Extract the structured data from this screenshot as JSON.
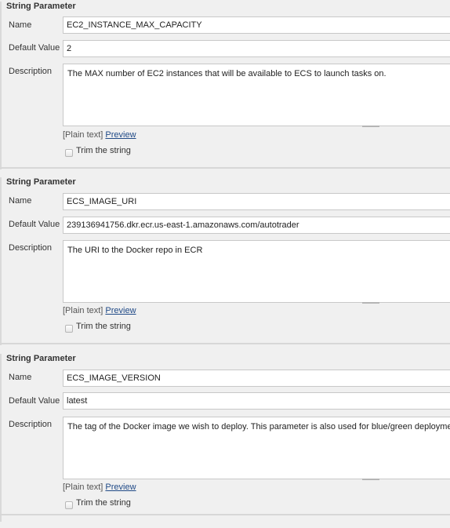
{
  "parameters": [
    {
      "section_title": "String Parameter",
      "name_label": "Name",
      "name_value": "EC2_INSTANCE_MAX_CAPACITY",
      "default_label": "Default Value",
      "default_value": "2",
      "description_label": "Description",
      "description_value": "The MAX number of EC2 instances that will be available to ECS to launch tasks on.",
      "plain_text_label": "[Plain text]",
      "preview_link": "Preview",
      "trim_label": "Trim the string",
      "trim_checked": false
    },
    {
      "section_title": "String Parameter",
      "name_label": "Name",
      "name_value": "ECS_IMAGE_URI",
      "default_label": "Default Value",
      "default_value": "239136941756.dkr.ecr.us-east-1.amazonaws.com/autotrader",
      "description_label": "Description",
      "description_value": "The URI to the Docker repo in ECR",
      "plain_text_label": "[Plain text]",
      "preview_link": "Preview",
      "trim_label": "Trim the string",
      "trim_checked": false
    },
    {
      "section_title": "String Parameter",
      "name_label": "Name",
      "name_value": "ECS_IMAGE_VERSION",
      "default_label": "Default Value",
      "default_value": "latest",
      "description_label": "Description",
      "description_value": "The tag of the Docker image we wish to deploy. This parameter is also used for blue/green deployments.",
      "plain_text_label": "[Plain text]",
      "preview_link": "Preview",
      "trim_label": "Trim the string",
      "trim_checked": false
    }
  ]
}
